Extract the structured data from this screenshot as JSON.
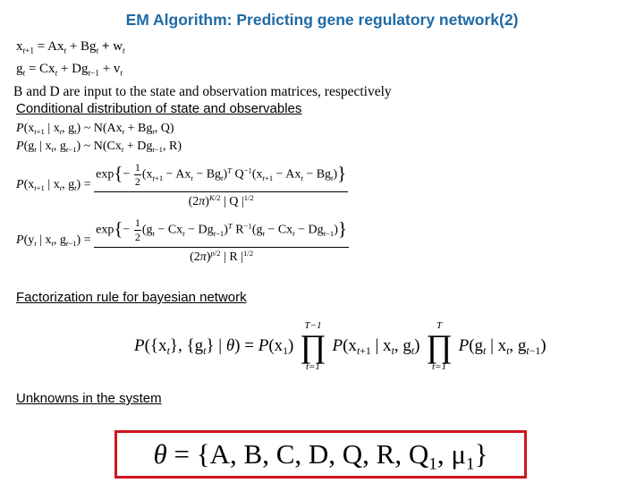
{
  "title": "EM Algorithm: Predicting gene regulatory network(2)",
  "colors": {
    "title": "#1f6aa5",
    "box_border": "#d0161f"
  },
  "model": {
    "state_eq": "x_{t+1} = Ax_t + Bg_t + w_t",
    "obs_eq": "g_t = Cx_t + Dg_{t-1} + v_t",
    "note": "B and D are input to the state and observation matrices, respectively"
  },
  "sections": {
    "conditional": "Conditional distribution of state and observables",
    "factorization": "Factorization rule for bayesian network",
    "unknowns": "Unknowns in the system"
  },
  "conditional": {
    "state_dist": "P(x_{t+1} | x_t, g_t) ~ N(Ax_t + Bg_t, Q)",
    "obs_dist": "P(g_t | x_t, g_{t-1}) ~ N(Cx_t + Dg_{t-1}, R)",
    "state_pdf": "P(x_{t+1} | x_t, g_t) = exp{-1/2 (x_{t+1} - Ax_t - Bg_t)^T Q^{-1} (x_{t+1} - Ax_t - Bg_t)} / ((2π)^{K/2} |Q|^{1/2})",
    "obs_pdf": "P(y_t | x_t, g_{t-1}) = exp{-1/2 (g_t - Cx_t - Dg_{t-1})^T R^{-1} (g_t - Cx_t - Dg_{t-1})} / ((2π)^{p/2} |R|^{1/2})"
  },
  "factorization": {
    "formula": "P({x_t},{g_t} | θ) = P(x_1) ∏_{t=1}^{T-1} P(x_{t+1} | x_t, g_t) ∏_{t=1}^{T} P(g_t | x_t, g_{t-1})",
    "prod1_upper": "T−1",
    "prod1_lower": "t=1",
    "prod2_upper": "T",
    "prod2_lower": "t=1"
  },
  "unknowns": {
    "formula": "θ = {A, B, C, D, Q, R, Q_1, μ_1}"
  }
}
